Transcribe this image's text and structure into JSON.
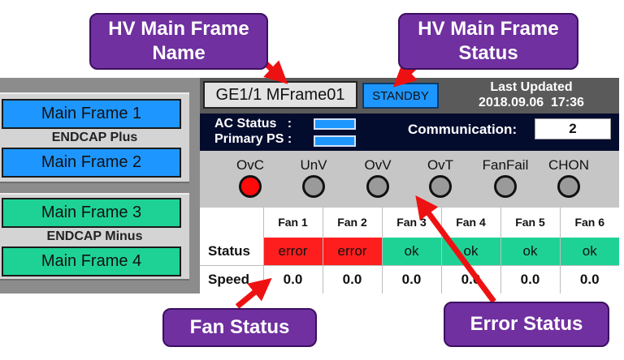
{
  "colors": {
    "accent_blue": "#1e96ff",
    "accent_green": "#1ed296",
    "error_red": "#ff1e1e",
    "callout_purple": "#7030a0",
    "arrow_red": "#ee1111"
  },
  "left_panel": {
    "endcap_plus": {
      "label": "ENDCAP Plus",
      "frames": [
        "Main Frame 1",
        "Main Frame 2"
      ]
    },
    "endcap_minus": {
      "label": "ENDCAP Minus",
      "frames": [
        "Main Frame 3",
        "Main Frame 4"
      ]
    }
  },
  "header": {
    "frame_name": "GE1/1 MFrame01",
    "frame_status": "STANDBY",
    "last_updated_label": "Last Updated",
    "last_updated_value": "2018.09.06  17:36"
  },
  "info": {
    "ac_status_label": "AC Status   :",
    "primary_ps_label": "Primary PS :",
    "communication_label": "Communication:",
    "communication_value": "2"
  },
  "indicators": [
    {
      "label": "OvC",
      "state": "on"
    },
    {
      "label": "UnV",
      "state": "off"
    },
    {
      "label": "OvV",
      "state": "off"
    },
    {
      "label": "OvT",
      "state": "off"
    },
    {
      "label": "FanFail",
      "state": "off"
    },
    {
      "label": "CHON",
      "state": "off"
    }
  ],
  "fan_table": {
    "status_label": "Status",
    "speed_label": "Speed",
    "fans": [
      {
        "name": "Fan 1",
        "status": "error",
        "speed": "0.0"
      },
      {
        "name": "Fan 2",
        "status": "error",
        "speed": "0.0"
      },
      {
        "name": "Fan 3",
        "status": "ok",
        "speed": "0.0"
      },
      {
        "name": "Fan 4",
        "status": "ok",
        "speed": "0.0"
      },
      {
        "name": "Fan 5",
        "status": "ok",
        "speed": "0.0"
      },
      {
        "name": "Fan 6",
        "status": "ok",
        "speed": "0.0"
      }
    ]
  },
  "callouts": {
    "frame_name": "HV Main Frame Name",
    "frame_status": "HV Main Frame Status",
    "fan_status": "Fan Status",
    "error_status": "Error Status"
  }
}
